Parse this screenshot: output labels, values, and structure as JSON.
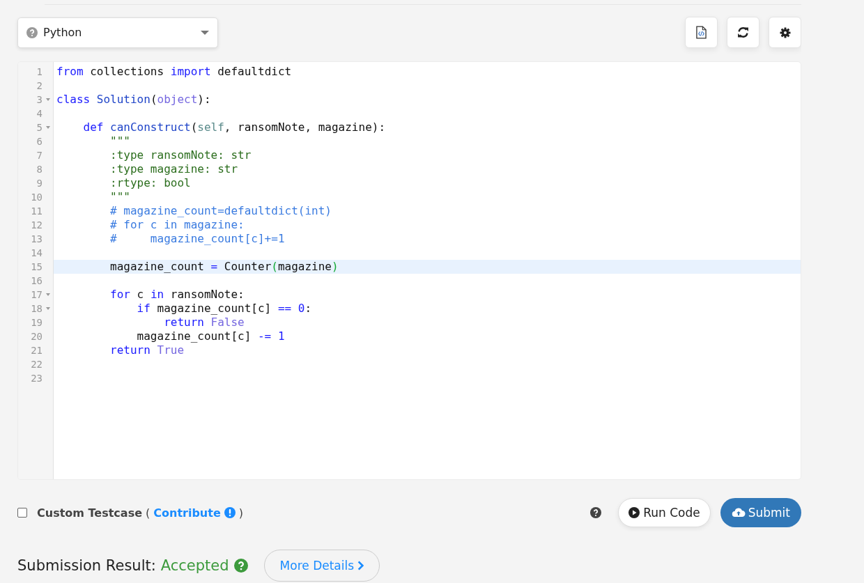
{
  "language_select": {
    "value": "Python"
  },
  "code_lines": [
    {
      "number": "1",
      "foldable": false,
      "highlighted": false,
      "tokens": [
        {
          "kind": "keyword",
          "text": "from"
        },
        {
          "kind": "plain",
          "text": " collections "
        },
        {
          "kind": "keyword",
          "text": "import"
        },
        {
          "kind": "plain",
          "text": " defaultdict"
        }
      ]
    },
    {
      "number": "2",
      "foldable": false,
      "highlighted": false
    },
    {
      "number": "3",
      "foldable": true,
      "highlighted": false,
      "tokens": [
        {
          "kind": "keyword",
          "text": "class"
        },
        {
          "kind": "function",
          "text": " Solution"
        },
        {
          "kind": "plain",
          "text": "("
        },
        {
          "kind": "builtin",
          "text": "object"
        },
        {
          "kind": "plain",
          "text": "):"
        }
      ]
    },
    {
      "number": "4",
      "foldable": false,
      "highlighted": false
    },
    {
      "number": "5",
      "foldable": true,
      "highlighted": false,
      "tokens": [
        {
          "kind": "keyword",
          "text": "    def"
        },
        {
          "kind": "function",
          "text": " canConstruct"
        },
        {
          "kind": "plain",
          "text": "("
        },
        {
          "kind": "self",
          "text": "self"
        },
        {
          "kind": "plain",
          "text": ", ransomNote, magazine):"
        }
      ]
    },
    {
      "number": "6",
      "foldable": false,
      "highlighted": false,
      "tokens": [
        {
          "kind": "string",
          "text": "        \"\"\""
        }
      ]
    },
    {
      "number": "7",
      "foldable": false,
      "highlighted": false,
      "tokens": [
        {
          "kind": "string",
          "text": "        :type ransomNote: str"
        }
      ]
    },
    {
      "number": "8",
      "foldable": false,
      "highlighted": false,
      "tokens": [
        {
          "kind": "string",
          "text": "        :type magazine: str"
        }
      ]
    },
    {
      "number": "9",
      "foldable": false,
      "highlighted": false,
      "tokens": [
        {
          "kind": "string",
          "text": "        :rtype: bool"
        }
      ]
    },
    {
      "number": "10",
      "foldable": false,
      "highlighted": false,
      "tokens": [
        {
          "kind": "string",
          "text": "        \"\"\""
        }
      ]
    },
    {
      "number": "11",
      "foldable": false,
      "highlighted": false,
      "tokens": [
        {
          "kind": "comment",
          "text": "        # magazine_count=defaultdict(int)"
        }
      ]
    },
    {
      "number": "12",
      "foldable": false,
      "highlighted": false,
      "tokens": [
        {
          "kind": "comment",
          "text": "        # for c in magazine:"
        }
      ]
    },
    {
      "number": "13",
      "foldable": false,
      "highlighted": false,
      "tokens": [
        {
          "kind": "comment",
          "text": "        #     magazine_count[c]+=1"
        }
      ]
    },
    {
      "number": "14",
      "foldable": false,
      "highlighted": false
    },
    {
      "number": "15",
      "foldable": false,
      "highlighted": true,
      "tokens": [
        {
          "kind": "plain",
          "text": "        magazine_count "
        },
        {
          "kind": "operator",
          "text": "="
        },
        {
          "kind": "plain",
          "text": " Counter"
        },
        {
          "kind": "bracket",
          "text": "("
        },
        {
          "kind": "plain",
          "text": "magazine"
        },
        {
          "kind": "bracket",
          "text": ")"
        }
      ]
    },
    {
      "number": "16",
      "foldable": false,
      "highlighted": false
    },
    {
      "number": "17",
      "foldable": true,
      "highlighted": false,
      "tokens": [
        {
          "kind": "keyword",
          "text": "        for"
        },
        {
          "kind": "plain",
          "text": " c "
        },
        {
          "kind": "keyword",
          "text": "in"
        },
        {
          "kind": "plain",
          "text": " ransomNote:"
        }
      ]
    },
    {
      "number": "18",
      "foldable": true,
      "highlighted": false,
      "tokens": [
        {
          "kind": "keyword",
          "text": "            if"
        },
        {
          "kind": "plain",
          "text": " magazine_count[c] "
        },
        {
          "kind": "operator",
          "text": "=="
        },
        {
          "kind": "number",
          "text": " 0"
        },
        {
          "kind": "plain",
          "text": ":"
        }
      ]
    },
    {
      "number": "19",
      "foldable": false,
      "highlighted": false,
      "tokens": [
        {
          "kind": "keyword",
          "text": "                return"
        },
        {
          "kind": "builtin",
          "text": " False"
        }
      ]
    },
    {
      "number": "20",
      "foldable": false,
      "highlighted": false,
      "tokens": [
        {
          "kind": "plain",
          "text": "            magazine_count[c] "
        },
        {
          "kind": "operator",
          "text": "-="
        },
        {
          "kind": "number",
          "text": " 1"
        }
      ]
    },
    {
      "number": "21",
      "foldable": false,
      "highlighted": false,
      "tokens": [
        {
          "kind": "keyword",
          "text": "        return"
        },
        {
          "kind": "builtin",
          "text": " True"
        }
      ]
    },
    {
      "number": "22",
      "foldable": false,
      "highlighted": false
    },
    {
      "number": "23",
      "foldable": false,
      "highlighted": false
    }
  ],
  "custom_testcase": {
    "checked": false,
    "label": "Custom Testcase",
    "open_paren": "(",
    "link": "Contribute",
    "close_paren": ")"
  },
  "run_button": "Run Code",
  "submit_button": "Submit",
  "result": {
    "label": "Submission Result:",
    "status": "Accepted",
    "details_button": "More Details"
  }
}
